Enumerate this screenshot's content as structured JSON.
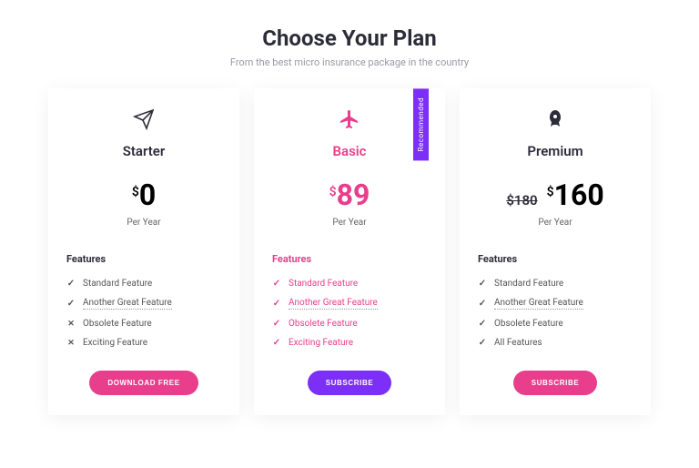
{
  "header": {
    "title": "Choose Your Plan",
    "subtitle": "From the best micro insurance package in the country"
  },
  "plans": [
    {
      "icon": "paper-plane",
      "name": "Starter",
      "accent": false,
      "currency": "$",
      "amount": "0",
      "old_price": null,
      "period": "Per Year",
      "features_title": "Features",
      "features": [
        {
          "mark": "check",
          "label": "Standard Feature",
          "dotted": false
        },
        {
          "mark": "check",
          "label": "Another Great Feature",
          "dotted": true
        },
        {
          "mark": "cross",
          "label": "Obsolete Feature",
          "dotted": false
        },
        {
          "mark": "cross",
          "label": "Exciting Feature",
          "dotted": false
        }
      ],
      "button": {
        "label": "DOWNLOAD FREE",
        "style": "pink"
      },
      "ribbon": null
    },
    {
      "icon": "plane",
      "name": "Basic",
      "accent": true,
      "currency": "$",
      "amount": "89",
      "old_price": null,
      "period": "Per Year",
      "features_title": "Features",
      "features": [
        {
          "mark": "check",
          "label": "Standard Feature",
          "dotted": false
        },
        {
          "mark": "check",
          "label": "Another Great Feature",
          "dotted": true
        },
        {
          "mark": "check",
          "label": "Obsolete Feature",
          "dotted": false
        },
        {
          "mark": "check",
          "label": "Exciting Feature",
          "dotted": false
        }
      ],
      "button": {
        "label": "SUBSCRIBE",
        "style": "purple"
      },
      "ribbon": "Recommended"
    },
    {
      "icon": "rocket",
      "name": "Premium",
      "accent": false,
      "currency": "$",
      "amount": "160",
      "old_price": "$180",
      "period": "Per Year",
      "features_title": "Features",
      "features": [
        {
          "mark": "check",
          "label": "Standard Feature",
          "dotted": false
        },
        {
          "mark": "check",
          "label": "Another Great Feature",
          "dotted": true
        },
        {
          "mark": "check",
          "label": "Obsolete Feature",
          "dotted": false
        },
        {
          "mark": "check",
          "label": "All Features",
          "dotted": false
        }
      ],
      "button": {
        "label": "SUBSCRIBE",
        "style": "pink"
      },
      "ribbon": null
    }
  ]
}
